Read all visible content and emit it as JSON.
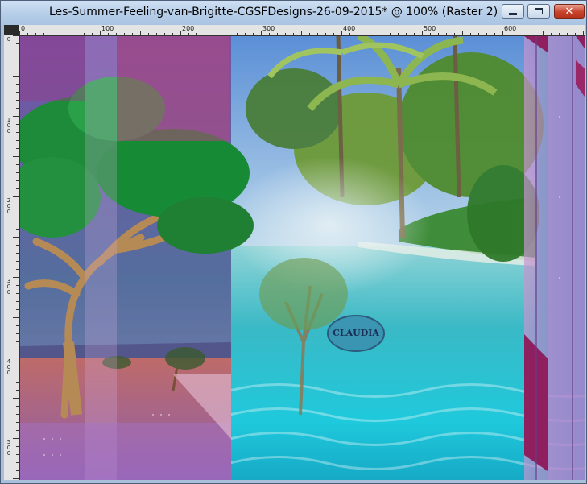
{
  "window": {
    "title": "Les-Summer-Feeling-van-Brigitte-CGSFDesigns-26-09-2015* @ 100% (Raster 2)",
    "buttons": {
      "minimize": "minimize",
      "maximize": "maximize",
      "close": "✕"
    }
  },
  "rulers": {
    "horizontal_labels": [
      "0",
      "100",
      "200",
      "300",
      "400",
      "500",
      "600"
    ],
    "vertical_labels": [
      "0",
      "100",
      "200",
      "300",
      "400",
      "500"
    ]
  },
  "image": {
    "watermark": "CLAUDIA",
    "description_icons": [
      "tree-icon",
      "palm-icon"
    ],
    "colors": {
      "sea": "#2fc4d0",
      "purple": "#8c58b8",
      "magenta": "#a0306e",
      "foliage": "#1f8a3a"
    }
  }
}
